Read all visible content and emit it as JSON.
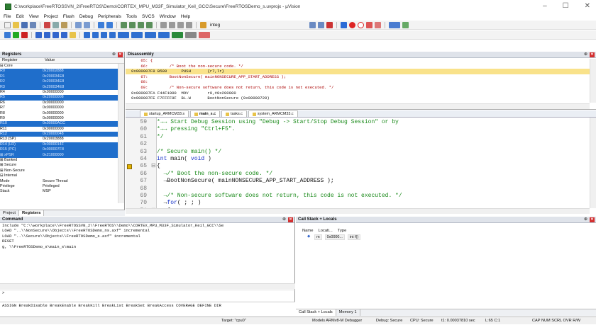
{
  "window": {
    "title": "C:\\workplace\\FreeRTOSSVN_2\\FreeRTOS\\Demo\\CORTEX_MPU_M33F_Simulator_Keil_GCC\\Secure\\FreeRTOSDemo_s.uvprojx - µVision",
    "minimize": "–",
    "restore": "☐",
    "close": "✕"
  },
  "menu": [
    "File",
    "Edit",
    "View",
    "Project",
    "Flash",
    "Debug",
    "Peripherals",
    "Tools",
    "SVCS",
    "Window",
    "Help"
  ],
  "toolbar": {
    "target_field": "integ"
  },
  "registers": {
    "title": "Registers",
    "col_register": "Register",
    "col_value": "Value",
    "rows": [
      {
        "name": "⊟ Core",
        "value": "",
        "sel": false
      },
      {
        "name": "    R0",
        "value": "0x20002888",
        "sel": true
      },
      {
        "name": "    R1",
        "value": "0x200034E8",
        "sel": true
      },
      {
        "name": "    R2",
        "value": "0x200034E8",
        "sel": true
      },
      {
        "name": "    R3",
        "value": "0x200034E8",
        "sel": true
      },
      {
        "name": "    R4",
        "value": "0x00000000",
        "sel": false
      },
      {
        "name": "    R5",
        "value": "0x20000008",
        "sel": true
      },
      {
        "name": "    R6",
        "value": "0x00000000",
        "sel": false
      },
      {
        "name": "    R7",
        "value": "0x00000000",
        "sel": false
      },
      {
        "name": "    R8",
        "value": "0x00000000",
        "sel": false
      },
      {
        "name": "    R9",
        "value": "0x00000000",
        "sel": false
      },
      {
        "name": "    R10",
        "value": "0x00000ACC",
        "sel": true
      },
      {
        "name": "    R11",
        "value": "0x00000000",
        "sel": false
      },
      {
        "name": "    R12",
        "value": "0x20000048",
        "sel": true
      },
      {
        "name": "    R13 (SP)",
        "value": "0x20003888",
        "sel": false
      },
      {
        "name": "    R14 (LR)",
        "value": "0x0000014F",
        "sel": true
      },
      {
        "name": "    R15 (PC)",
        "value": "0x000007F8",
        "sel": true
      },
      {
        "name": "  ⊞ xPSR",
        "value": "0x21000000",
        "sel": true
      },
      {
        "name": "⊞ Banked",
        "value": "",
        "sel": false
      },
      {
        "name": "⊞ Secure",
        "value": "",
        "sel": false
      },
      {
        "name": "⊞ Non-Secure",
        "value": "",
        "sel": false
      },
      {
        "name": "⊟ Internal",
        "value": "",
        "sel": false
      },
      {
        "name": "    Mode",
        "value": "Secure Thread",
        "sel": false
      },
      {
        "name": "    Privilege",
        "value": "Privileged",
        "sel": false
      },
      {
        "name": "    Stack",
        "value": "MSP",
        "sel": false
      }
    ],
    "tabs": [
      "Project",
      "Registers"
    ]
  },
  "disassembly": {
    "title": "Disassembly",
    "lines": [
      {
        "t": "    65: {",
        "cur": false
      },
      {
        "t": "    66:         /* Boot the non-secure code. */",
        "cur": false
      },
      {
        "t": "0x000007F8 B580      PUSH       {r7,lr}",
        "cur": true
      },
      {
        "t": "    67:         BootNonSecure( mainNONSECURE_APP_START_ADDRESS );",
        "cur": false
      },
      {
        "t": "    68:",
        "cur": false
      },
      {
        "t": "    69:         /* Non-secure software does not return, this code is not executed. */",
        "cur": false
      },
      {
        "t": "0x000007FA F44F1000  MOV        r0,#0x200000",
        "cur": false
      },
      {
        "t": "0x000007FE F7FFFF9F  BL.W       BootNonSecure (0x00000720)",
        "cur": false
      }
    ]
  },
  "editor": {
    "tabs": [
      "startup_ARMCM33.s",
      "main_s.c",
      "tasks.c",
      "system_ARMCM33.c"
    ],
    "lines": [
      {
        "n": "59",
        "pre": "  ",
        "code": "*→→ Start Debug Session using \"Debug -> Start/Stop Debug Session\" or by",
        "kind": "cm"
      },
      {
        "n": "60",
        "pre": "  ",
        "code": "*→→ pressing \"Ctrl+F5\".",
        "kind": "cm"
      },
      {
        "n": "61",
        "pre": "  ",
        "code": "*/",
        "kind": "cm"
      },
      {
        "n": "62",
        "pre": "",
        "code": "",
        "kind": "cd"
      },
      {
        "n": "63",
        "pre": "",
        "code": "/* Secure main() */",
        "kind": "cm"
      },
      {
        "n": "64",
        "pre": "",
        "code": "int main( void )",
        "kind": "cd"
      },
      {
        "n": "65",
        "pre": "⊟",
        "code": "{",
        "kind": "cd"
      },
      {
        "n": "66",
        "pre": "",
        "code": "  →/* Boot the non-secure code. */",
        "kind": "cm"
      },
      {
        "n": "67",
        "pre": "",
        "code": "  →BootNonSecure( mainNONSECURE_APP_START_ADDRESS );",
        "kind": "cd"
      },
      {
        "n": "68",
        "pre": "",
        "code": "",
        "kind": "cd"
      },
      {
        "n": "69",
        "pre": "",
        "code": "  →/* Non-secure software does not return, this code is not executed. */",
        "kind": "cm"
      },
      {
        "n": "70",
        "pre": "",
        "code": "  →for( ; ; )",
        "kind": "cd"
      },
      {
        "n": "71",
        "pre": "⊟",
        "code": "  →{",
        "kind": "cd"
      }
    ]
  },
  "command": {
    "title": "Command",
    "lines": [
      "Include \"C:\\\\workplace\\\\FreeRTOSSVN_2\\\\FreeRTOS\\\\Demo\\\\CORTEX_MPU_M33F_Simulator_Keil_GCC\\\\Se",
      "LOAD \"..\\\\NonSecure\\\\Objects\\\\FreeRTOSDemo_ns.axf\" incremental",
      "LOAD \"..\\\\Secure\\\\Objects\\\\FreeRTOSDemo_s.axf\" incremental",
      "RESET",
      "g, \\\\FreeRTOSDemo_s\\main_s\\main"
    ],
    "prompt": ">",
    "keywords": "ASSIGN BreakDisable BreakEnable BreakKill BreakList BreakSet BreakAccess COVERAGE DEFINE DIR"
  },
  "callstack": {
    "title": "Call Stack + Locals",
    "col_name": "Name",
    "col_location": "Locati...",
    "col_type": "Type",
    "row_name": "m",
    "row_location": "0x0000...",
    "row_type": "int f()",
    "tabs": [
      "Call Stack + Locals",
      "Memory 1"
    ]
  },
  "status": {
    "target": "Target: \"cpu0\"",
    "debugger": "Models ARMv8-M Debugger",
    "debug": "Debug: Secure",
    "cpu": "CPU: Secure",
    "time": "t1: 0.00037810 sec",
    "pos": "L:65 C:1",
    "flags": "CAP  NUM  SCRL  OVR  R/W"
  }
}
